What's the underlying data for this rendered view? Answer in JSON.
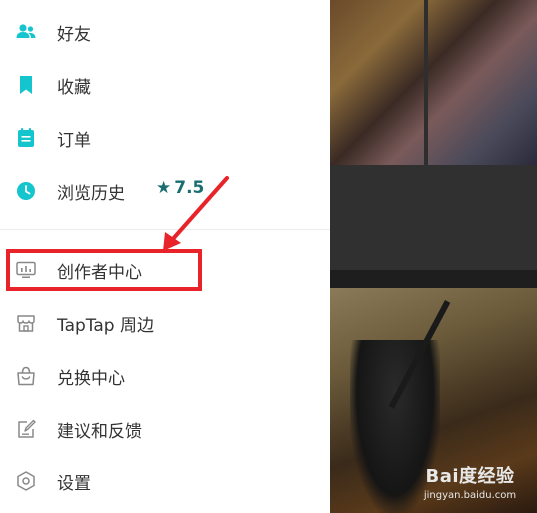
{
  "drawer": {
    "items": [
      {
        "label": "好友",
        "icon": "friends-icon"
      },
      {
        "label": "收藏",
        "icon": "bookmark-icon"
      },
      {
        "label": "订单",
        "icon": "order-icon"
      },
      {
        "label": "浏览历史",
        "icon": "clock-icon"
      },
      {
        "label": "创作者中心",
        "icon": "monitor-icon"
      },
      {
        "label": "TapTap 周边",
        "icon": "store-icon"
      },
      {
        "label": "兑换中心",
        "icon": "bag-icon"
      },
      {
        "label": "建议和反馈",
        "icon": "edit-icon"
      },
      {
        "label": "设置",
        "icon": "settings-icon"
      }
    ],
    "highlighted_item": "创作者中心"
  },
  "content": {
    "rating": "7.5"
  },
  "watermark": {
    "logo": "Bai度经验",
    "url": "jingyan.baidu.com"
  },
  "colors": {
    "accent": "#15c5ce",
    "outline_icon": "#888888",
    "highlight": "#e8232a",
    "rating": "#1a6e72"
  }
}
